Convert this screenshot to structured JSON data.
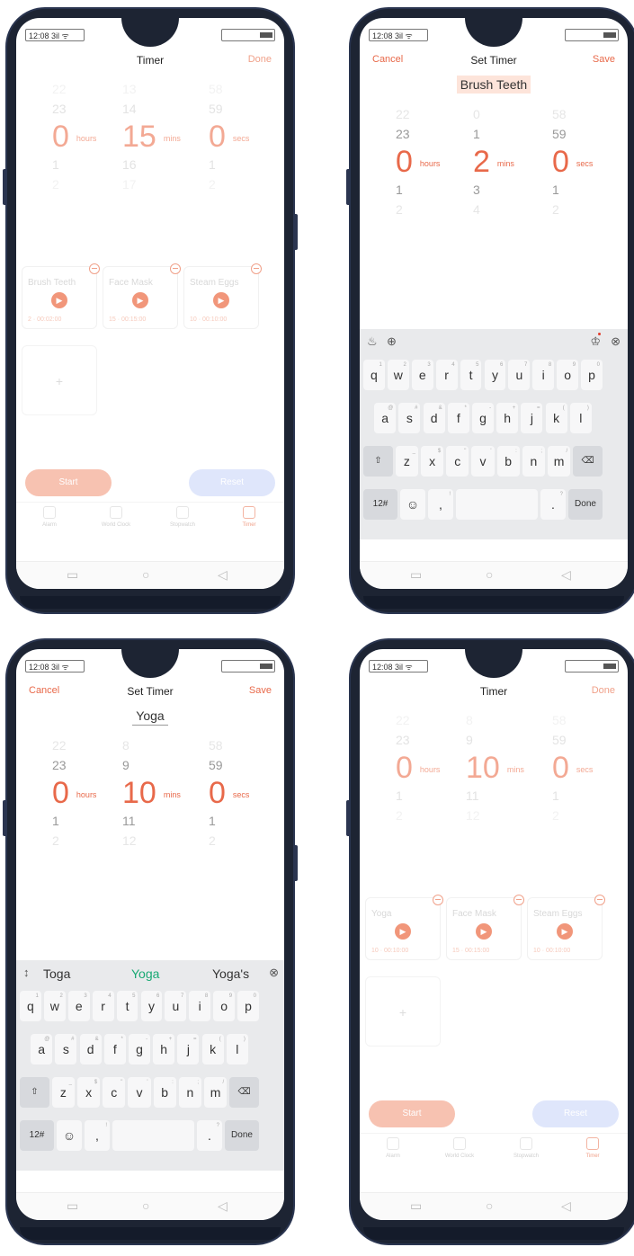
{
  "status": {
    "time": "12:08 3il ᯤ"
  },
  "keyboard": {
    "rows": [
      [
        {
          "k": "q",
          "h": "1"
        },
        {
          "k": "w",
          "h": "2"
        },
        {
          "k": "e",
          "h": "3"
        },
        {
          "k": "r",
          "h": "4"
        },
        {
          "k": "t",
          "h": "5"
        },
        {
          "k": "y",
          "h": "6"
        },
        {
          "k": "u",
          "h": "7"
        },
        {
          "k": "i",
          "h": "8"
        },
        {
          "k": "o",
          "h": "9"
        },
        {
          "k": "p",
          "h": "0"
        }
      ],
      [
        {
          "k": "a",
          "h": "@"
        },
        {
          "k": "s",
          "h": "#"
        },
        {
          "k": "d",
          "h": "&"
        },
        {
          "k": "f",
          "h": "*"
        },
        {
          "k": "g",
          "h": "-"
        },
        {
          "k": "h",
          "h": "+"
        },
        {
          "k": "j",
          "h": "="
        },
        {
          "k": "k",
          "h": "("
        },
        {
          "k": "l",
          "h": ")"
        }
      ],
      [
        {
          "k": "⇧",
          "h": "",
          "fn": true
        },
        {
          "k": "z",
          "h": "_"
        },
        {
          "k": "x",
          "h": "$"
        },
        {
          "k": "c",
          "h": "\""
        },
        {
          "k": "v",
          "h": "'"
        },
        {
          "k": "b",
          "h": ":"
        },
        {
          "k": "n",
          "h": ";"
        },
        {
          "k": "m",
          "h": "/"
        },
        {
          "k": "⌫",
          "h": "",
          "fn": true
        }
      ],
      [
        {
          "k": "12#",
          "h": "",
          "fn": true
        },
        {
          "k": "☺",
          "h": ""
        },
        {
          "k": ",",
          "h": "!"
        },
        {
          "k": "",
          "h": ""
        },
        {
          "k": ".",
          "h": "?"
        },
        {
          "k": "Done",
          "h": "",
          "fn": true
        }
      ]
    ]
  },
  "screens": [
    {
      "header": {
        "left": "",
        "title": "Timer",
        "right": "Done"
      },
      "name_field": "",
      "picker": {
        "hours": {
          "far_above": "22",
          "above": "23",
          "value": "0",
          "below": "1",
          "far_below": "2",
          "unit": "hours"
        },
        "mins": {
          "far_above": "13",
          "above": "14",
          "value": "15",
          "below": "16",
          "far_below": "17",
          "unit": "mins"
        },
        "secs": {
          "far_above": "58",
          "above": "59",
          "value": "0",
          "below": "1",
          "far_below": "2",
          "unit": "secs"
        }
      },
      "presets": [
        {
          "name": "Brush Teeth",
          "duration": "2 · 00:02:00"
        },
        {
          "name": "Face Mask",
          "duration": "15 · 00:15:00"
        },
        {
          "name": "Steam Eggs",
          "duration": "10 · 00:10:00"
        }
      ],
      "add_label": "+",
      "buttons": {
        "start": "Start",
        "reset": "Reset"
      },
      "tabs": [
        {
          "label": "Alarm",
          "active": false
        },
        {
          "label": "World Clock",
          "active": false
        },
        {
          "label": "Stopwatch",
          "active": false
        },
        {
          "label": "Timer",
          "active": true
        }
      ]
    },
    {
      "header": {
        "left": "Cancel",
        "title": "Set Timer",
        "right": "Save"
      },
      "name_field": "Brush Teeth",
      "picker": {
        "hours": {
          "far_above": "22",
          "above": "23",
          "value": "0",
          "below": "1",
          "far_below": "2",
          "unit": "hours"
        },
        "mins": {
          "far_above": "0",
          "above": "1",
          "value": "2",
          "below": "3",
          "far_below": "4",
          "unit": "mins"
        },
        "secs": {
          "far_above": "58",
          "above": "59",
          "value": "0",
          "below": "1",
          "far_below": "2",
          "unit": "secs"
        }
      },
      "keyboard_toolbar": {
        "left1": "♨",
        "left2": "⊕",
        "right1": "♔",
        "right2": "⊗"
      }
    },
    {
      "header": {
        "left": "Cancel",
        "title": "Set Timer",
        "right": "Save"
      },
      "name_field": "Yoga",
      "picker": {
        "hours": {
          "far_above": "22",
          "above": "23",
          "value": "0",
          "below": "1",
          "far_below": "2",
          "unit": "hours"
        },
        "mins": {
          "far_above": "8",
          "above": "9",
          "value": "10",
          "below": "11",
          "far_below": "12",
          "unit": "mins"
        },
        "secs": {
          "far_above": "58",
          "above": "59",
          "value": "0",
          "below": "1",
          "far_below": "2",
          "unit": "secs"
        }
      },
      "suggestions": {
        "tool": "↕",
        "left": "Toga",
        "middle": "Yoga",
        "right": "Yoga's",
        "close": "⊗"
      }
    },
    {
      "header": {
        "left": "",
        "title": "Timer",
        "right": "Done"
      },
      "name_field": "",
      "picker": {
        "hours": {
          "far_above": "22",
          "above": "23",
          "value": "0",
          "below": "1",
          "far_below": "2",
          "unit": "hours"
        },
        "mins": {
          "far_above": "8",
          "above": "9",
          "value": "10",
          "below": "11",
          "far_below": "12",
          "unit": "mins"
        },
        "secs": {
          "far_above": "58",
          "above": "59",
          "value": "0",
          "below": "1",
          "far_below": "2",
          "unit": "secs"
        }
      },
      "presets": [
        {
          "name": "Yoga",
          "duration": "10 · 00:10:00"
        },
        {
          "name": "Face Mask",
          "duration": "15 · 00:15:00"
        },
        {
          "name": "Steam Eggs",
          "duration": "10 · 00:10:00"
        }
      ],
      "add_label": "+",
      "buttons": {
        "start": "Start",
        "reset": "Reset"
      },
      "tabs": [
        {
          "label": "Alarm",
          "active": false
        },
        {
          "label": "World Clock",
          "active": false
        },
        {
          "label": "Stopwatch",
          "active": false
        },
        {
          "label": "Timer",
          "active": true
        }
      ]
    }
  ]
}
